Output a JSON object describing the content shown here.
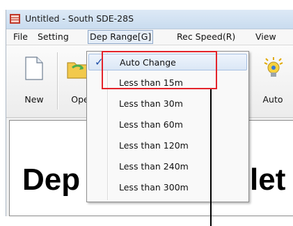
{
  "window": {
    "title": "Untitled - South SDE-28S"
  },
  "menubar": {
    "items": [
      "File",
      "Setting",
      "Dep Range[G]",
      "Rec Speed(R)",
      "View"
    ]
  },
  "toolbar": {
    "buttons": [
      {
        "label": "New",
        "icon": "new-document-icon"
      },
      {
        "label": "Ope",
        "icon": "open-folder-icon"
      },
      {
        "label": "Auto",
        "icon": "auto-bulb-icon"
      }
    ]
  },
  "content": {
    "heading_left": "Dep",
    "heading_right": "let"
  },
  "dropdown": {
    "items": [
      {
        "label": "Auto Change",
        "checked": true
      },
      {
        "label": "Less than 15m",
        "checked": false
      },
      {
        "label": "Less than 30m",
        "checked": false
      },
      {
        "label": "Less than 60m",
        "checked": false
      },
      {
        "label": "Less than 120m",
        "checked": false
      },
      {
        "label": "Less than 240m",
        "checked": false
      },
      {
        "label": "Less than 300m",
        "checked": false
      }
    ],
    "check_glyph": "✓"
  },
  "colors": {
    "annotation_red": "#e4232a",
    "selection_blue": "#dbe7f6",
    "check_blue": "#1f4fa8"
  }
}
